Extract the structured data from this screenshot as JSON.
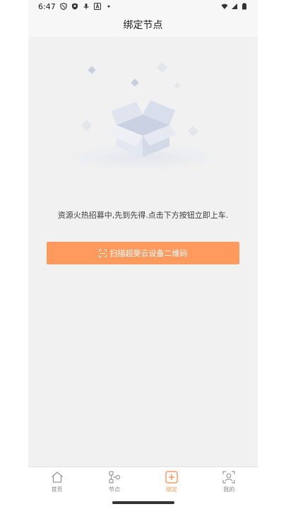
{
  "status_bar": {
    "time": "6:47",
    "icons_left": [
      "shield-icon",
      "security-badge-icon",
      "mic-icon",
      "a-box-icon",
      "dot-icon"
    ],
    "icons_right": [
      "wifi-icon",
      "signal-icon",
      "battery-icon"
    ]
  },
  "header": {
    "title": "绑定节点"
  },
  "empty_state": {
    "illustration": "empty-box-icon",
    "message": "资源火热招募中,先到先得.点击下方按钮立即上车."
  },
  "scan_button": {
    "icon": "scan-icon",
    "label": "扫描超斐云设备二维码"
  },
  "tab_bar": {
    "tabs": [
      {
        "label": "首页",
        "icon": "home-icon"
      },
      {
        "label": "节点",
        "icon": "nodes-icon"
      },
      {
        "label": "绑定",
        "icon": "add-box-icon"
      },
      {
        "label": "我的",
        "icon": "profile-icon"
      }
    ],
    "active_index": 2
  },
  "colors": {
    "accent": "#ff9a5f",
    "background": "#f1f1f1",
    "tab_inactive": "#888888"
  }
}
